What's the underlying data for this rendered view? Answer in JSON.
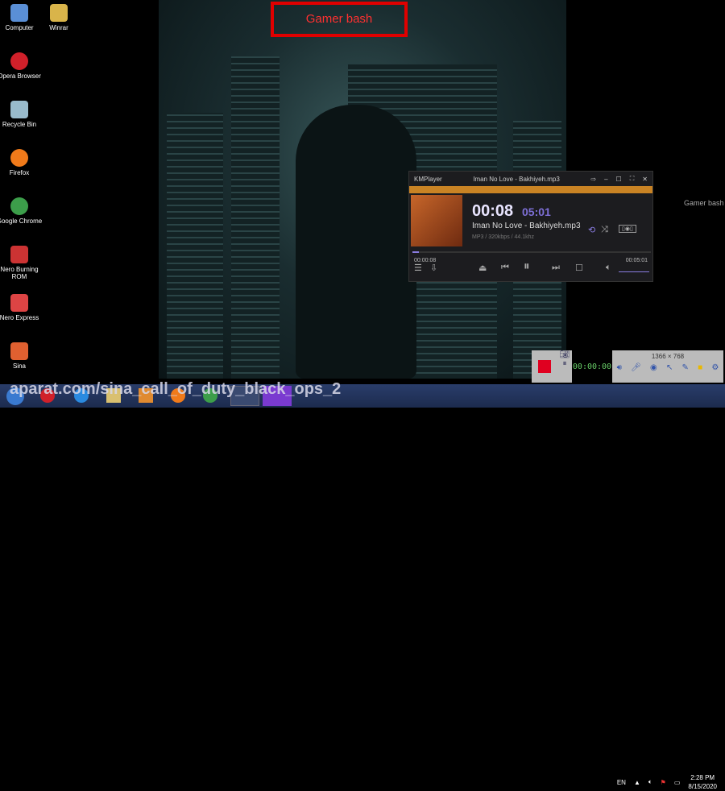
{
  "desktop": {
    "icons": [
      {
        "label": "Computer",
        "color": "#5a8fd6"
      },
      {
        "label": "Opera Browser",
        "color": "#d0202a"
      },
      {
        "label": "Recycle Bin",
        "color": "#9bc"
      },
      {
        "label": "Firefox",
        "color": "#f07a1a"
      },
      {
        "label": "Google Chrome",
        "color": "#3c9e4a"
      },
      {
        "label": "Nero Burning ROM",
        "color": "#c33"
      },
      {
        "label": "Nero Express",
        "color": "#d44"
      },
      {
        "label": "Sina",
        "color": "#e06030"
      }
    ],
    "icon2": {
      "label": "Winrar"
    },
    "overlay_title": "Gamer bash",
    "side_text": "Gamer bash"
  },
  "kmplayer": {
    "app": "KMPlayer",
    "title": "Iman No Love - Bakhiyeh.mp3",
    "current": "00:08",
    "total": "05:01",
    "track": "Iman No Love - Bakhiyeh.mp3",
    "info": "MP3 / 320kbps / 44.1khz",
    "elapsed": "00:00:08",
    "duration": "00:05:01",
    "progress": 0.027
  },
  "recorder": {
    "resolution": "1366 × 768",
    "counter": "00:00:00"
  },
  "watermark": "aparat.com/sina_call_of_duty_black_ops_2",
  "tray": {
    "lang": "EN",
    "time": "2:28 PM",
    "date": "8/15/2020"
  }
}
